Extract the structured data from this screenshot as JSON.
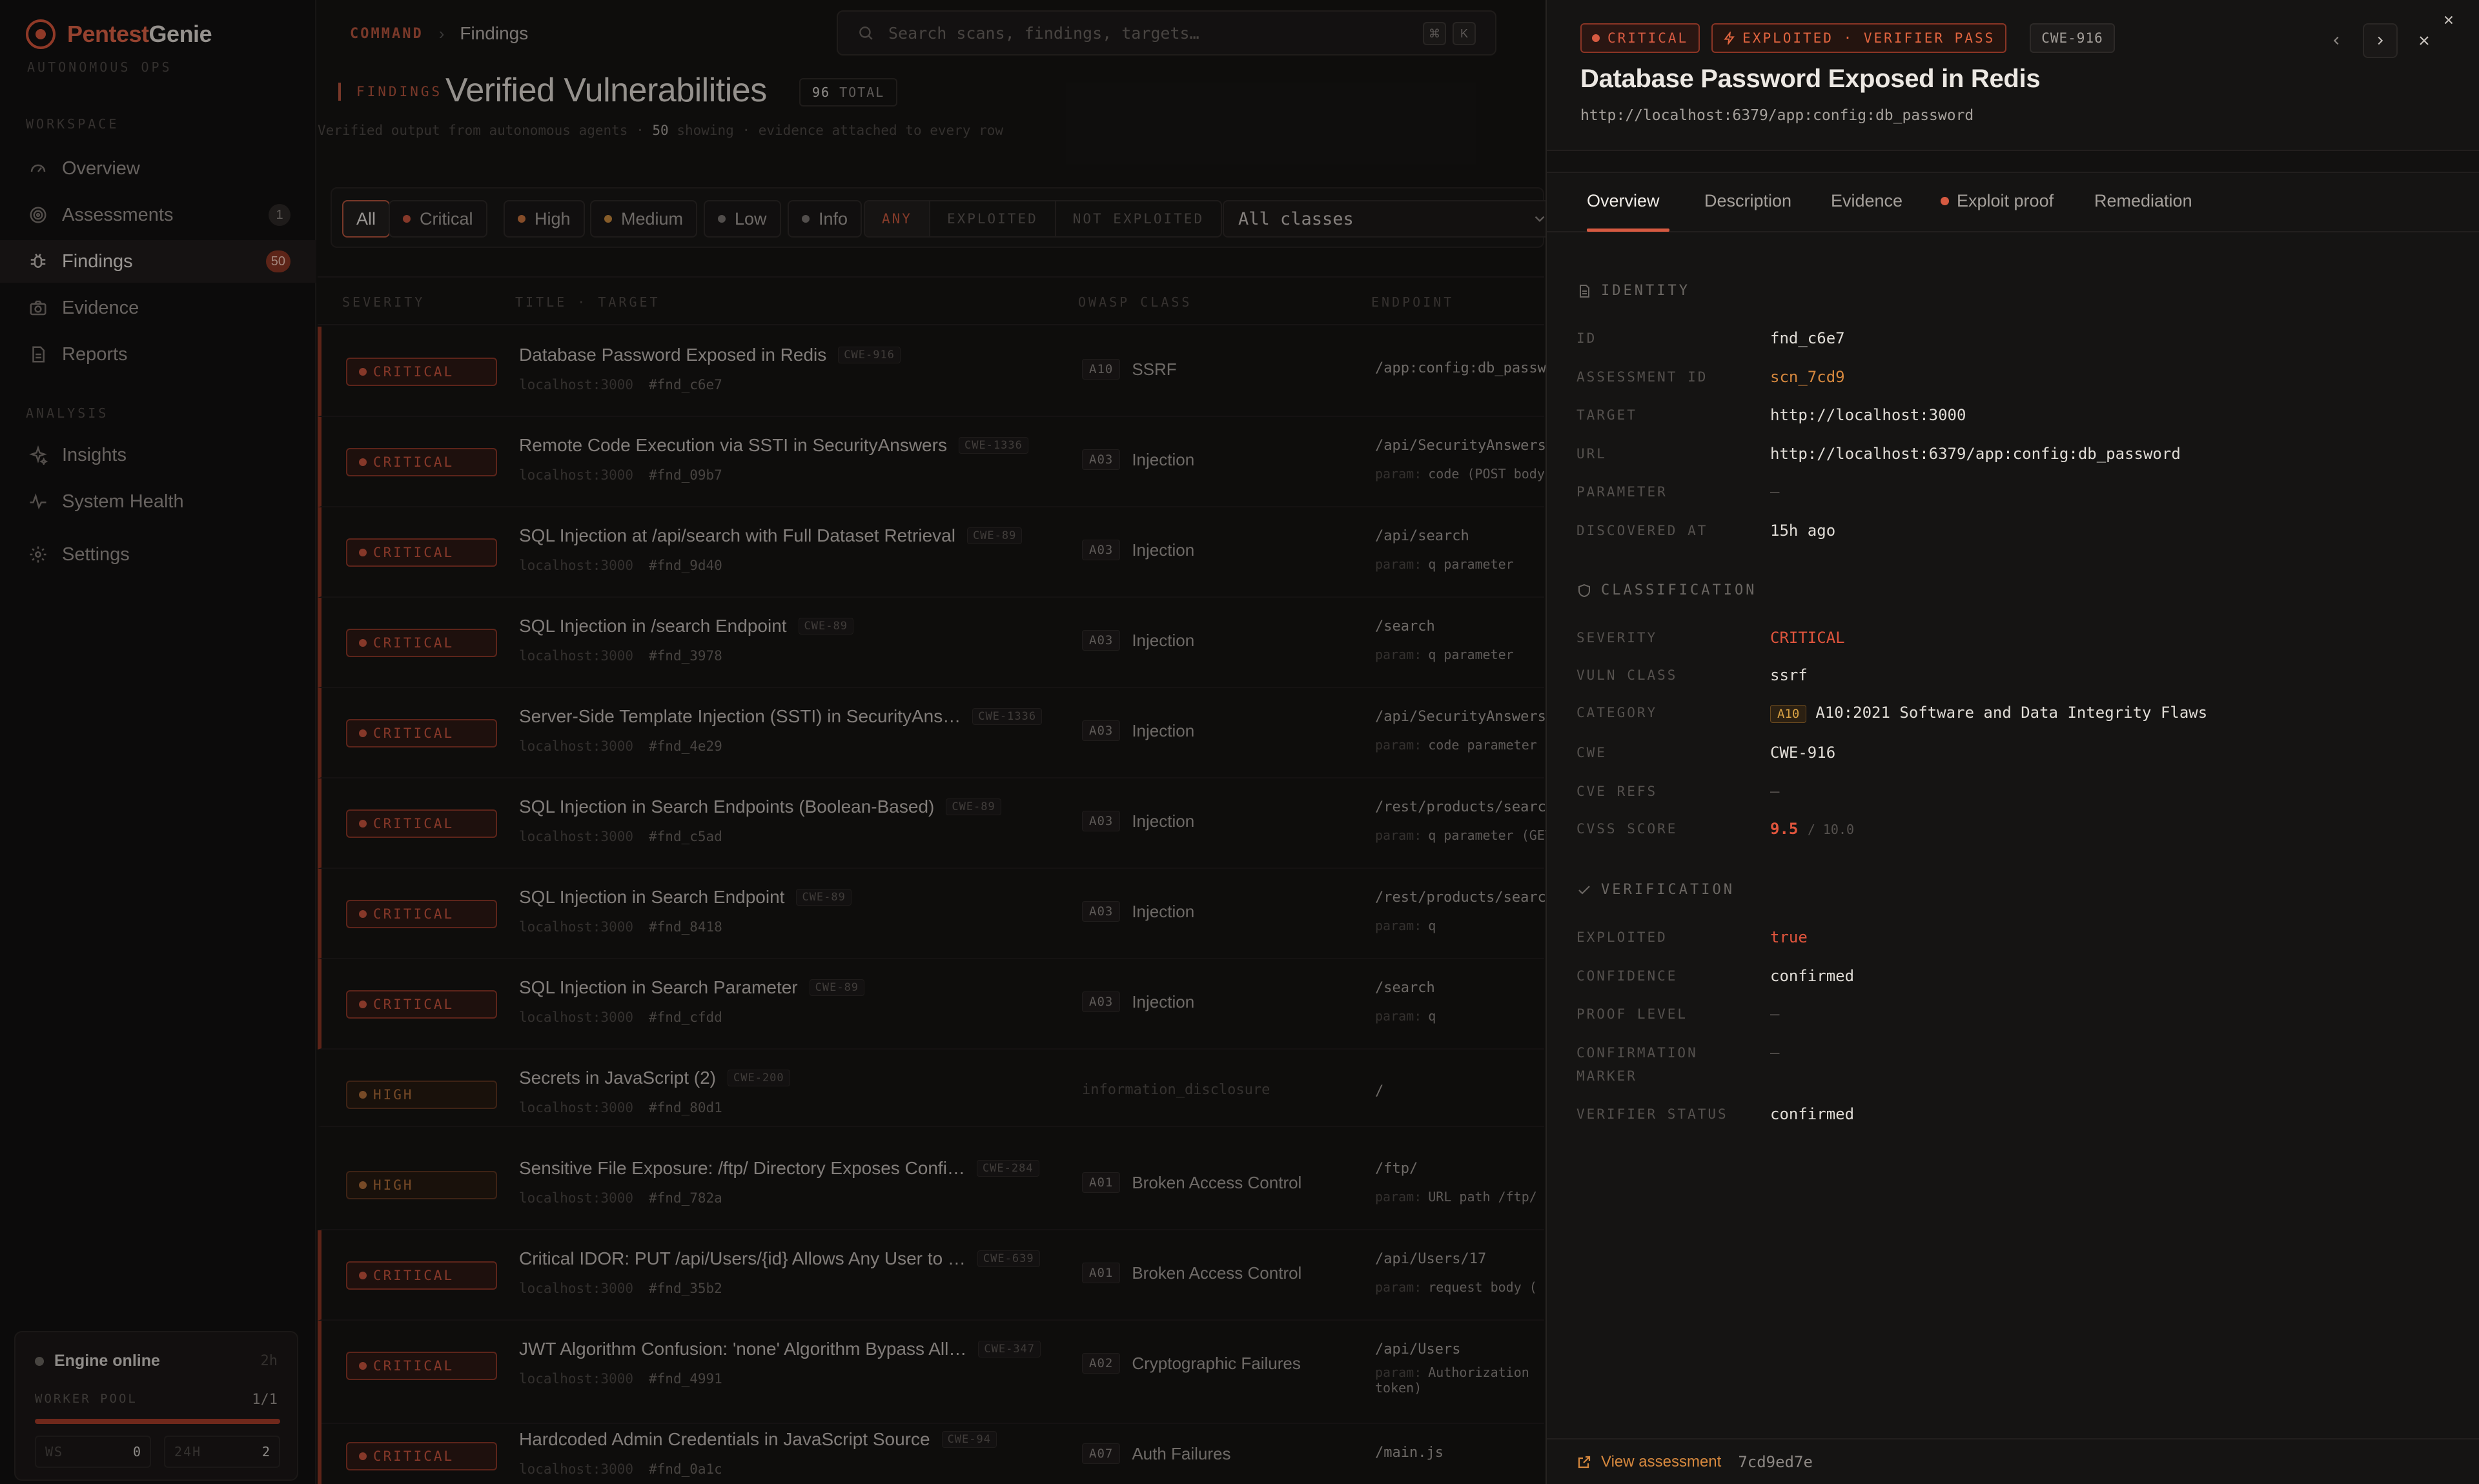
{
  "brand": {
    "name_a": "Pentest",
    "name_b": "Genie",
    "subtitle": "AUTONOMOUS OPS"
  },
  "sidebar": {
    "workspace_label": "WORKSPACE",
    "analysis_label": "ANALYSIS",
    "items": [
      {
        "label": "Overview",
        "icon": "gauge-icon"
      },
      {
        "label": "Assessments",
        "icon": "radar-icon",
        "badge": "1"
      },
      {
        "label": "Findings",
        "icon": "bug-icon",
        "badge": "50"
      },
      {
        "label": "Evidence",
        "icon": "camera-icon"
      },
      {
        "label": "Reports",
        "icon": "document-icon"
      },
      {
        "label": "Insights",
        "icon": "sparkle-icon"
      },
      {
        "label": "System Health",
        "icon": "pulse-icon"
      },
      {
        "label": "Settings",
        "icon": "gear-icon"
      }
    ],
    "engine": {
      "status": "Engine online",
      "uptime": "2h",
      "worker_pool_label": "WORKER POOL",
      "worker_pool_value": "1/1",
      "worker_pool_fraction": 1.0,
      "ws_label": "WS",
      "ws_value": "0",
      "h24_label": "24H",
      "h24_value": "2"
    }
  },
  "header": {
    "crumb_root": "COMMAND",
    "crumb_page": "Findings",
    "search_placeholder": "Search scans, findings, targets…",
    "kbd_1": "⌘",
    "kbd_2": "K",
    "tag": "FINDINGS",
    "title": "Verified Vulnerabilities",
    "total_count": "96",
    "total_label": "TOTAL",
    "sub_a": "Verified output from autonomous agents · ",
    "sub_count": "50",
    "sub_b": " showing · evidence attached to every row"
  },
  "filters": {
    "chips": [
      "All",
      "Critical",
      "High",
      "Medium",
      "Low",
      "Info"
    ],
    "chip_colors": [
      "",
      "#c9533d",
      "#c9733d",
      "#c98a3d",
      "#7a7672",
      "#7a7672"
    ],
    "exploit_segments": [
      "ANY",
      "EXPLOITED",
      "NOT EXPLOITED"
    ],
    "class_select": "All classes"
  },
  "table": {
    "columns": [
      "SEVERITY",
      "TITLE · TARGET",
      "OWASP CLASS",
      "ENDPOINT"
    ],
    "rows": [
      {
        "sev": "CRITICAL",
        "title": "Database Password Exposed in Redis",
        "cwe": "CWE-916",
        "target": "localhost:3000",
        "fid": "#fnd_c6e7",
        "code": "A10",
        "owasp": "SSRF",
        "endpoint": "/app:config:db_password",
        "param_k": "",
        "param_v": ""
      },
      {
        "sev": "CRITICAL",
        "title": "Remote Code Execution via SSTI in SecurityAnswers",
        "cwe": "CWE-1336",
        "target": "localhost:3000",
        "fid": "#fnd_09b7",
        "code": "A03",
        "owasp": "Injection",
        "endpoint": "/api/SecurityAnswers",
        "param_k": "param:",
        "param_v": "code (POST body)"
      },
      {
        "sev": "CRITICAL",
        "title": "SQL Injection at /api/search with Full Dataset Retrieval",
        "cwe": "CWE-89",
        "target": "localhost:3000",
        "fid": "#fnd_9d40",
        "code": "A03",
        "owasp": "Injection",
        "endpoint": "/api/search",
        "param_k": "param:",
        "param_v": "q parameter"
      },
      {
        "sev": "CRITICAL",
        "title": "SQL Injection in /search Endpoint",
        "cwe": "CWE-89",
        "target": "localhost:3000",
        "fid": "#fnd_3978",
        "code": "A03",
        "owasp": "Injection",
        "endpoint": "/search",
        "param_k": "param:",
        "param_v": "q parameter"
      },
      {
        "sev": "CRITICAL",
        "title": "Server-Side Template Injection (SSTI) in SecurityAns…",
        "cwe": "CWE-1336",
        "target": "localhost:3000",
        "fid": "#fnd_4e29",
        "code": "A03",
        "owasp": "Injection",
        "endpoint": "/api/SecurityAnswers",
        "param_k": "param:",
        "param_v": "code parameter"
      },
      {
        "sev": "CRITICAL",
        "title": "SQL Injection in Search Endpoints (Boolean-Based)",
        "cwe": "CWE-89",
        "target": "localhost:3000",
        "fid": "#fnd_c5ad",
        "code": "A03",
        "owasp": "Injection",
        "endpoint": "/rest/products/search",
        "param_k": "param:",
        "param_v": "q parameter (GET)"
      },
      {
        "sev": "CRITICAL",
        "title": "SQL Injection in Search Endpoint",
        "cwe": "CWE-89",
        "target": "localhost:3000",
        "fid": "#fnd_8418",
        "code": "A03",
        "owasp": "Injection",
        "endpoint": "/rest/products/search",
        "param_k": "param:",
        "param_v": "q"
      },
      {
        "sev": "CRITICAL",
        "title": "SQL Injection in Search Parameter",
        "cwe": "CWE-89",
        "target": "localhost:3000",
        "fid": "#fnd_cfdd",
        "code": "A03",
        "owasp": "Injection",
        "endpoint": "/search",
        "param_k": "param:",
        "param_v": "q"
      },
      {
        "sev": "HIGH",
        "title": "Secrets in JavaScript (2)",
        "cwe": "CWE-200",
        "target": "localhost:3000",
        "fid": "#fnd_80d1",
        "code": "",
        "owasp": "information_disclosure",
        "endpoint": "/",
        "param_k": "",
        "param_v": ""
      },
      {
        "sev": "HIGH",
        "title": "Sensitive File Exposure: /ftp/ Directory Exposes Confi…",
        "cwe": "CWE-284",
        "target": "localhost:3000",
        "fid": "#fnd_782a",
        "code": "A01",
        "owasp": "Broken Access Control",
        "endpoint": "/ftp/",
        "param_k": "param:",
        "param_v": "URL path /ftp/"
      },
      {
        "sev": "CRITICAL",
        "title": "Critical IDOR: PUT /api/Users/{id} Allows Any User to …",
        "cwe": "CWE-639",
        "target": "localhost:3000",
        "fid": "#fnd_35b2",
        "code": "A01",
        "owasp": "Broken Access Control",
        "endpoint": "/api/Users/17",
        "param_k": "param:",
        "param_v": "request body ("
      },
      {
        "sev": "CRITICAL",
        "title": "JWT Algorithm Confusion: 'none' Algorithm Bypass All…",
        "cwe": "CWE-347",
        "target": "localhost:3000",
        "fid": "#fnd_4991",
        "code": "A02",
        "owasp": "Cryptographic Failures",
        "endpoint": "/api/Users",
        "param_k": "param:",
        "param_v": "Authorization",
        "param_v2": "token)"
      },
      {
        "sev": "CRITICAL",
        "title": "Hardcoded Admin Credentials in JavaScript Source",
        "cwe": "CWE-94",
        "target": "localhost:3000",
        "fid": "#fnd_0a1c",
        "code": "A07",
        "owasp": "Auth Failures",
        "endpoint": "/main.js",
        "param_k": "",
        "param_v": ""
      }
    ]
  },
  "panel": {
    "tag_severity": "CRITICAL",
    "tag_exploit": "EXPLOITED · VERIFIER PASS",
    "tag_cwe": "CWE-916",
    "title": "Database Password Exposed in Redis",
    "url": "http://localhost:6379/app:config:db_password",
    "tabs": [
      "Overview",
      "Description",
      "Evidence",
      "Exploit proof",
      "Remediation"
    ],
    "identity": {
      "heading": "IDENTITY",
      "rows": [
        {
          "k": "ID",
          "v": "fnd_c6e7",
          "style": ""
        },
        {
          "k": "ASSESSMENT ID",
          "v": "scn_7cd9",
          "style": "orange"
        },
        {
          "k": "TARGET",
          "v": "http://localhost:3000",
          "style": ""
        },
        {
          "k": "URL",
          "v": "http://localhost:6379/app:config:db_password",
          "style": ""
        },
        {
          "k": "PARAMETER",
          "v": "—",
          "style": "dim"
        },
        {
          "k": "DISCOVERED AT",
          "v": "15h ago",
          "style": ""
        }
      ]
    },
    "classification": {
      "heading": "CLASSIFICATION",
      "severity_k": "SEVERITY",
      "severity_v": "CRITICAL",
      "vuln_k": "VULN CLASS",
      "vuln_v": "ssrf",
      "category_k": "CATEGORY",
      "category_code": "A10",
      "category_v": "A10:2021 Software and Data Integrity Flaws",
      "cwe_k": "CWE",
      "cwe_v": "CWE-916",
      "cve_k": "CVE REFS",
      "cve_v": "—",
      "cvss_k": "CVSS SCORE",
      "cvss_v": "9.5",
      "cvss_max": "/ 10.0"
    },
    "verification": {
      "heading": "VERIFICATION",
      "rows": [
        {
          "k": "EXPLOITED",
          "v": "true",
          "style": "red"
        },
        {
          "k": "CONFIDENCE",
          "v": "confirmed",
          "style": ""
        },
        {
          "k": "PROOF LEVEL",
          "v": "—",
          "style": "dim"
        },
        {
          "k": "CONFIRMATION MARKER",
          "v": "—",
          "style": "dim"
        },
        {
          "k": "VERIFIER STATUS",
          "v": "confirmed",
          "style": ""
        }
      ]
    },
    "footer_link": "View assessment",
    "footer_hash": "7cd9ed7e"
  },
  "colors": {
    "accent": "#d65a41",
    "critical": "#c9533d",
    "high": "#b26f3a",
    "link": "#d6883e"
  }
}
